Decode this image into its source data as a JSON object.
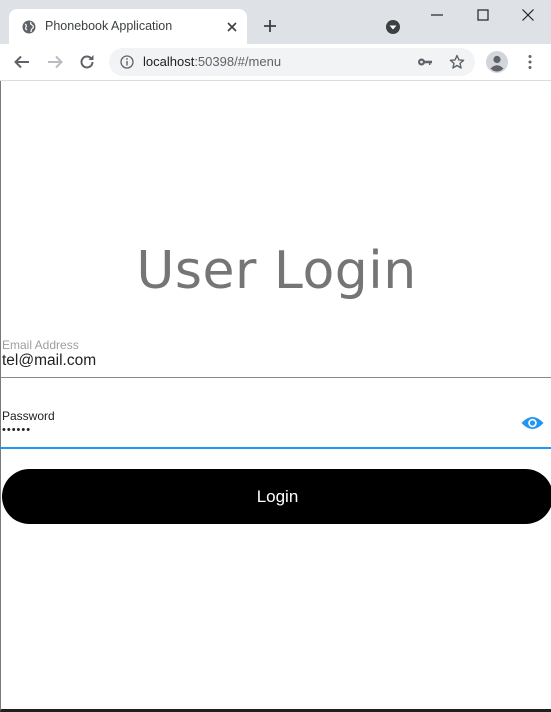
{
  "browser": {
    "tab": {
      "title": "Phonebook Application",
      "icon": "globe-icon"
    },
    "address_bar": {
      "host": "localhost",
      "path": ":50398/#/menu"
    },
    "colors": {
      "tabstrip": "#dee1e6",
      "omnibox": "#f1f3f4"
    }
  },
  "login": {
    "title": "User Login",
    "email": {
      "label": "Email Address",
      "value": "tel@mail.com"
    },
    "password": {
      "label": "Password",
      "value": "••••••",
      "toggle_icon": "eye-icon"
    },
    "button_label": "Login",
    "colors": {
      "accent": "#2196f3",
      "button": "#000000",
      "title": "#757575"
    }
  }
}
